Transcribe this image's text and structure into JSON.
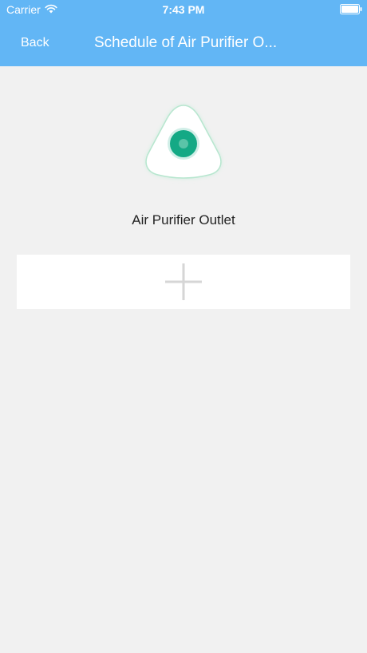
{
  "status_bar": {
    "carrier": "Carrier",
    "time": "7:43 PM",
    "wifi_icon": "wifi-icon",
    "battery_icon": "battery-icon"
  },
  "navbar": {
    "back_label": "Back",
    "title": "Schedule of Air Purifier O..."
  },
  "device": {
    "icon": "air-purifier-icon",
    "name": "Air Purifier Outlet"
  },
  "schedule": {
    "add_icon": "plus-icon"
  },
  "colors": {
    "navbar": "#62b6f5",
    "background": "#f1f1f1",
    "accent": "#14a985",
    "card": "#ffffff",
    "plus": "#d6d6d6"
  }
}
